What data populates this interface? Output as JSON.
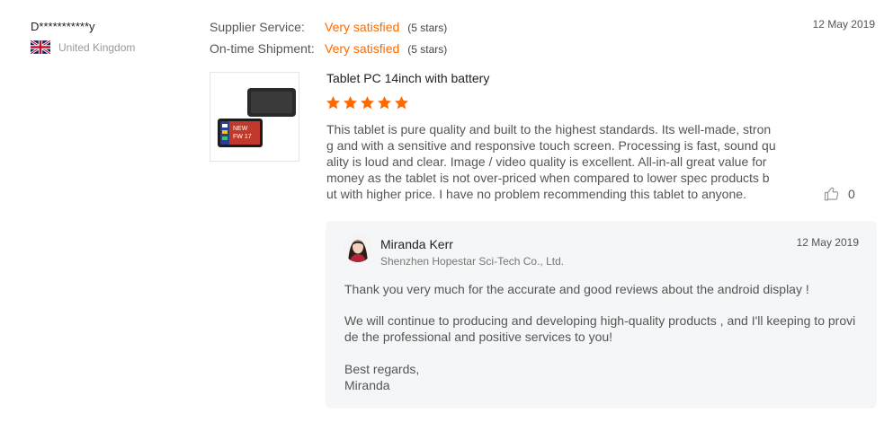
{
  "reviewer": {
    "name": "D***********y",
    "country": "United Kingdom"
  },
  "ratings": [
    {
      "label": "Supplier Service:",
      "value": "Very satisfied",
      "stars_text": "(5 stars)"
    },
    {
      "label": "On-time Shipment:",
      "value": "Very satisfied",
      "stars_text": "(5 stars)"
    }
  ],
  "review": {
    "date": "12 May 2019",
    "product_title": "Tablet PC 14inch with battery",
    "rating": 5,
    "text": "This tablet is pure quality and built to the highest standards. Its well-made, strong and with a sensitive and responsive touch screen. Processing is fast, sound quality is loud and clear. Image / video quality is excellent. All-in-all great value for money as the tablet is not over-priced when compared to lower spec products but with higher price. I have no problem recommending this tablet to anyone.",
    "likes": "0"
  },
  "reply": {
    "seller_name": "Miranda Kerr",
    "company": "Shenzhen Hopestar Sci-Tech Co., Ltd.",
    "date": "12 May 2019",
    "para1": "Thank you very much for the accurate and good reviews about the android display !",
    "para2": "We will continue to producing and developing high-quality products , and I'll keeping to provide the professional and positive services to you!",
    "para3_line1": "Best regards,",
    "para3_line2": "Miranda"
  },
  "thumb_badge": {
    "line1": "NEW",
    "line2": "FW 17"
  },
  "colors": {
    "accent": "#ff6a00",
    "reply_bg": "#f5f6f7"
  },
  "icons": {
    "flag": "uk-flag-icon",
    "star": "star-icon",
    "like": "thumbs-up-icon"
  }
}
